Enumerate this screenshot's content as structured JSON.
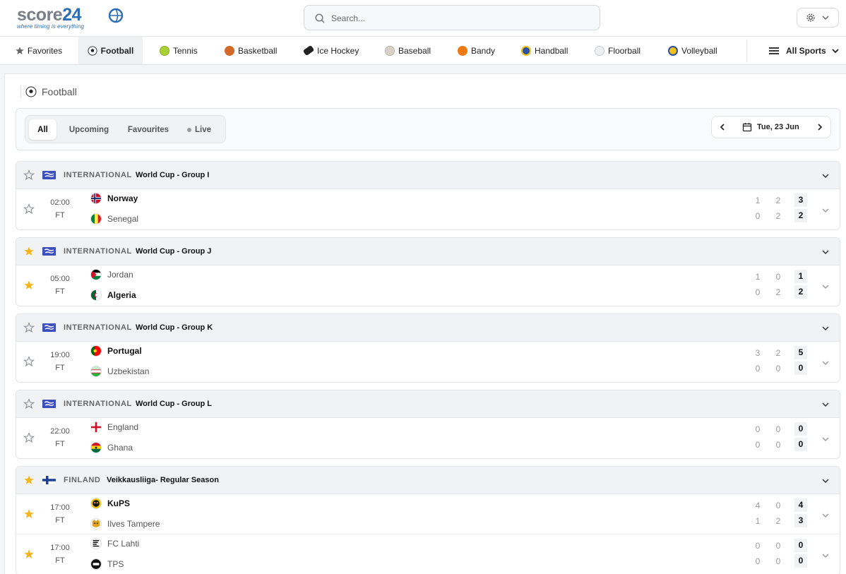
{
  "header": {
    "logo_text_a": "score",
    "logo_text_b": "24",
    "logo_tagline": "where timing is everything",
    "search_placeholder": "Search..."
  },
  "sports_nav": {
    "items": [
      {
        "label": "Favorites",
        "icon": "star-icon",
        "color": "#666666"
      },
      {
        "label": "Football",
        "icon": "football-icon",
        "color": "#222222",
        "active": true
      },
      {
        "label": "Tennis",
        "icon": "tennis-ball-icon",
        "color": "#a6d234"
      },
      {
        "label": "Basketball",
        "icon": "basketball-icon",
        "color": "#d46a2a"
      },
      {
        "label": "Ice Hockey",
        "icon": "hockey-puck-icon",
        "color": "#222222"
      },
      {
        "label": "Baseball",
        "icon": "baseball-icon",
        "color": "#c9c2b6"
      },
      {
        "label": "Bandy",
        "icon": "bandy-ball-icon",
        "color": "#f07a12"
      },
      {
        "label": "Handball",
        "icon": "handball-icon",
        "color": "#2a4fa3"
      },
      {
        "label": "Floorball",
        "icon": "floorball-icon",
        "color": "#dde3ea"
      },
      {
        "label": "Volleyball",
        "icon": "volleyball-icon",
        "color": "#f2c21b"
      }
    ],
    "all_sports_label": "All Sports"
  },
  "page": {
    "title": "Football",
    "filters": [
      "All",
      "Upcoming",
      "Favourites",
      "Live"
    ],
    "active_filter": "All",
    "date_label": "Tue, 23 Jun"
  },
  "leagues": [
    {
      "country": "INTERNATIONAL",
      "name": "World Cup - Group I",
      "favorite": false,
      "matches": [
        {
          "time": "02:00",
          "status": "FT",
          "favorite": false,
          "home": {
            "name": "Norway",
            "winner": true,
            "ht": "1",
            "p2": "2",
            "ft": "3"
          },
          "away": {
            "name": "Senegal",
            "winner": false,
            "ht": "0",
            "p2": "2",
            "ft": "2"
          }
        }
      ]
    },
    {
      "country": "INTERNATIONAL",
      "name": "World Cup - Group J",
      "favorite": true,
      "matches": [
        {
          "time": "05:00",
          "status": "FT",
          "favorite": true,
          "home": {
            "name": "Jordan",
            "winner": false,
            "ht": "1",
            "p2": "0",
            "ft": "1"
          },
          "away": {
            "name": "Algeria",
            "winner": true,
            "ht": "0",
            "p2": "2",
            "ft": "2"
          }
        }
      ]
    },
    {
      "country": "INTERNATIONAL",
      "name": "World Cup - Group K",
      "favorite": false,
      "matches": [
        {
          "time": "19:00",
          "status": "FT",
          "favorite": false,
          "home": {
            "name": "Portugal",
            "winner": true,
            "ht": "3",
            "p2": "2",
            "ft": "5"
          },
          "away": {
            "name": "Uzbekistan",
            "winner": false,
            "ht": "0",
            "p2": "0",
            "ft": "0"
          }
        }
      ]
    },
    {
      "country": "INTERNATIONAL",
      "name": "World Cup - Group L",
      "favorite": false,
      "matches": [
        {
          "time": "22:00",
          "status": "FT",
          "favorite": false,
          "home": {
            "name": "England",
            "winner": false,
            "ht": "0",
            "p2": "0",
            "ft": "0"
          },
          "away": {
            "name": "Ghana",
            "winner": false,
            "ht": "0",
            "p2": "0",
            "ft": "0"
          }
        }
      ]
    },
    {
      "country": "FINLAND",
      "name": "Veikkausliiga- Regular Season",
      "favorite": true,
      "matches": [
        {
          "time": "17:00",
          "status": "FT",
          "favorite": true,
          "home": {
            "name": "KuPS",
            "winner": true,
            "ht": "4",
            "p2": "0",
            "ft": "4"
          },
          "away": {
            "name": "Ilves Tampere",
            "winner": false,
            "ht": "1",
            "p2": "2",
            "ft": "3"
          }
        },
        {
          "time": "17:00",
          "status": "FT",
          "favorite": true,
          "home": {
            "name": "FC Lahti",
            "winner": false,
            "ht": "0",
            "p2": "0",
            "ft": "0"
          },
          "away": {
            "name": "TPS",
            "winner": false,
            "ht": "0",
            "p2": "0",
            "ft": "0"
          }
        }
      ]
    }
  ],
  "colors": {
    "brand_blue": "#2d6eb6",
    "favorite_star": "#f5b51b",
    "empty_star": "#8a8f96"
  }
}
